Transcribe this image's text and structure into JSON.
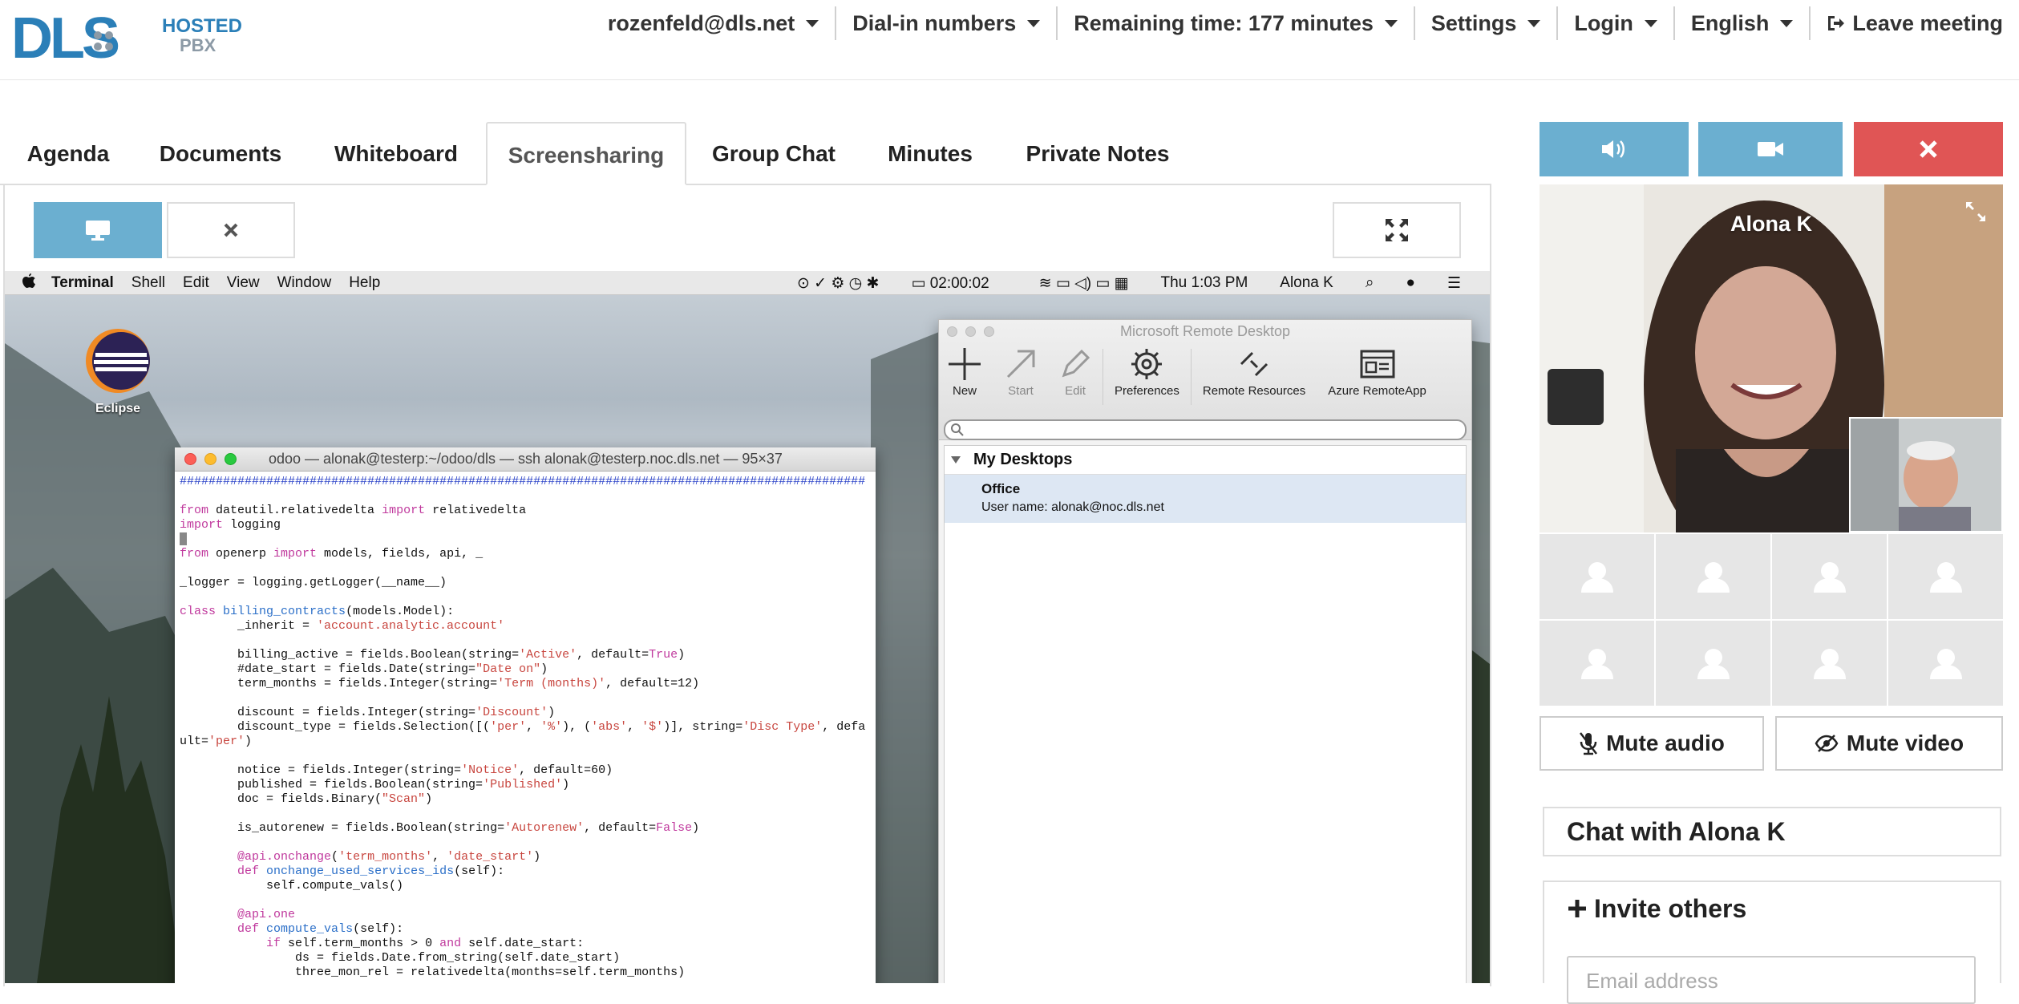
{
  "logo": {
    "brand": "DLS",
    "hosted": "HOSTED",
    "pbx": "PBX"
  },
  "topnav": {
    "user": "rozenfeld@dls.net",
    "dialin": "Dial-in numbers",
    "remaining": "Remaining time: 177 minutes",
    "settings": "Settings",
    "login": "Login",
    "language": "English",
    "leave": "Leave meeting"
  },
  "tabs": [
    "Agenda",
    "Documents",
    "Whiteboard",
    "Screensharing",
    "Group Chat",
    "Minutes",
    "Private Notes"
  ],
  "active_tab": "Screensharing",
  "mac_menubar": {
    "app": "Terminal",
    "menus": [
      "Shell",
      "Edit",
      "View",
      "Window",
      "Help"
    ],
    "battery_time": "02:00:02",
    "clock": "Thu 1:03 PM",
    "user": "Alona K"
  },
  "desktop_icon": {
    "label": "Eclipse"
  },
  "terminal": {
    "title": "odoo — alonak@testerp:~/odoo/dls — ssh alonak@testerp.noc.dls.net — 95×37",
    "lines": [
      "###############################################################################################",
      "",
      "from dateutil.relativedelta import relativedelta",
      "import logging",
      "",
      "from openerp import models, fields, api, _",
      "",
      "_logger = logging.getLogger(__name__)",
      "",
      "class billing_contracts(models.Model):",
      "        _inherit = 'account.analytic.account'",
      "",
      "        billing_active = fields.Boolean(string='Active', default=True)",
      "        #date_start = fields.Date(string=\"Date on\")",
      "        term_months = fields.Integer(string='Term (months)', default=12)",
      "",
      "        discount = fields.Integer(string='Discount')",
      "        discount_type = fields.Selection([('per', '%'), ('abs', '$')], string='Disc Type', defa",
      "ult='per')",
      "",
      "        notice = fields.Integer(string='Notice', default=60)",
      "        published = fields.Boolean(string='Published')",
      "        doc = fields.Binary(\"Scan\")",
      "",
      "        is_autorenew = fields.Boolean(string='Autorenew', default=False)",
      "",
      "        @api.onchange('term_months', 'date_start')",
      "        def onchange_used_services_ids(self):",
      "            self.compute_vals()",
      "",
      "        @api.one",
      "        def compute_vals(self):",
      "            if self.term_months > 0 and self.date_start:",
      "                ds = fields.Date.from_string(self.date_start)",
      "                three_mon_rel = relativedelta(months=self.term_months)"
    ]
  },
  "rdp": {
    "title": "Microsoft Remote Desktop",
    "tools": [
      "New",
      "Start",
      "Edit",
      "Preferences",
      "Remote Resources",
      "Azure RemoteApp"
    ],
    "group": "My Desktops",
    "desktop_name": "Office",
    "desktop_user": "User name: alonak@noc.dls.net"
  },
  "video": {
    "name": "Alona K"
  },
  "buttons": {
    "mute_audio": "Mute audio",
    "mute_video": "Mute video"
  },
  "chat": {
    "title": "Chat with Alona K"
  },
  "invite": {
    "title": "Invite others",
    "email_placeholder": "Email address"
  },
  "colors": {
    "accent": "#6bafd0",
    "danger": "#e05555"
  }
}
